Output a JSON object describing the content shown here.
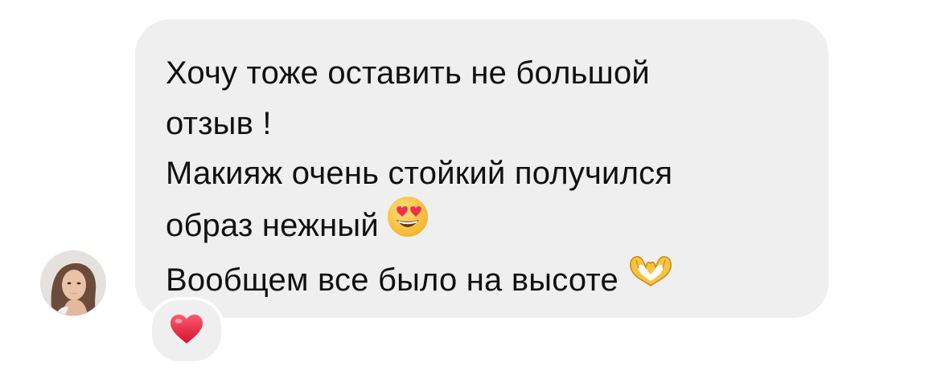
{
  "message": {
    "lines": [
      "Хочу тоже оставить не большой",
      "отзыв !",
      "Макияж очень стойкий получился",
      "образ нежный",
      "Вообщем все было на высоте"
    ],
    "emojis": [
      "heart-eyes-face-icon",
      "heart-hands-icon"
    ]
  },
  "reaction": {
    "emoji": "red-heart-icon"
  },
  "avatar": {
    "icon": "user-avatar"
  },
  "colors": {
    "bubble": "#efefef",
    "text": "#111111",
    "heart": "#e0245e",
    "emoji_yellow": "#f7c23a"
  }
}
